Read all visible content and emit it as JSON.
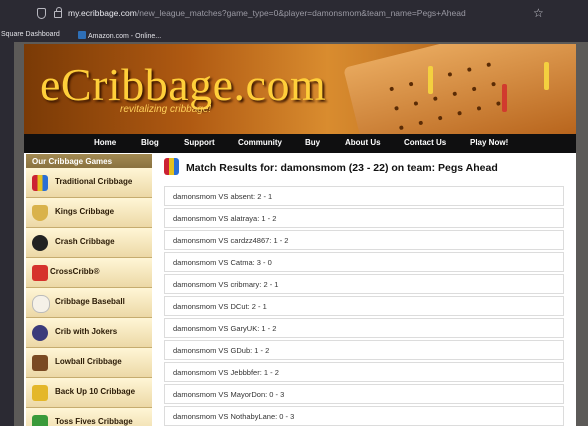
{
  "browser": {
    "url_host": "my.ecribbage.com",
    "url_path": "/new_league_matches?game_type=0&player=damonsmom&team_name=Pegs+Ahead"
  },
  "bookmarks": [
    {
      "label": "Square Dashboard"
    },
    {
      "label": "Amazon.com - Online..."
    }
  ],
  "site": {
    "logo": "eCribbage.com",
    "tagline": "revitalizing cribbage!"
  },
  "nav": [
    "Home",
    "Blog",
    "Support",
    "Community",
    "Buy",
    "About Us",
    "Contact Us",
    "Play Now!"
  ],
  "sidebar": {
    "title": "Our Cribbage Games",
    "items": [
      {
        "label": "Traditional Cribbage",
        "icon": "cards-icon"
      },
      {
        "label": "Kings Cribbage",
        "icon": "crown-shield-icon"
      },
      {
        "label": "Crash Cribbage",
        "icon": "crash-icon"
      },
      {
        "label": "CrossCribb®",
        "icon": "cross-icon"
      },
      {
        "label": "Cribbage Baseball",
        "icon": "baseball-icon"
      },
      {
        "label": "Crib with Jokers",
        "icon": "joker-icon"
      },
      {
        "label": "Lowball Cribbage",
        "icon": "lowball-icon"
      },
      {
        "label": "Back Up 10 Cribbage",
        "icon": "back-up-icon"
      },
      {
        "label": "Toss Fives Cribbage",
        "icon": "toss-fives-icon"
      }
    ]
  },
  "main": {
    "title": "Match Results for: damonsmom (23 - 22) on team: Pegs Ahead",
    "results": [
      "damonsmom VS absent: 2 - 1",
      "damonsmom VS alatraya: 1 - 2",
      "damonsmom VS cardzz4867: 1 - 2",
      "damonsmom VS Catma: 3 - 0",
      "damonsmom VS cribmary: 2 - 1",
      "damonsmom VS DCut: 2 - 1",
      "damonsmom VS GaryUK: 1 - 2",
      "damonsmom VS GDub: 1 - 2",
      "damonsmom VS Jebbbfer: 1 - 2",
      "damonsmom VS MayorDon: 0 - 3",
      "damonsmom VS NothabyLane: 0 - 3"
    ]
  },
  "colors": {
    "nav_bg": "#0f0f10",
    "sidebar_bg": "#f3e5c4",
    "logo": "#ffcf3a"
  }
}
